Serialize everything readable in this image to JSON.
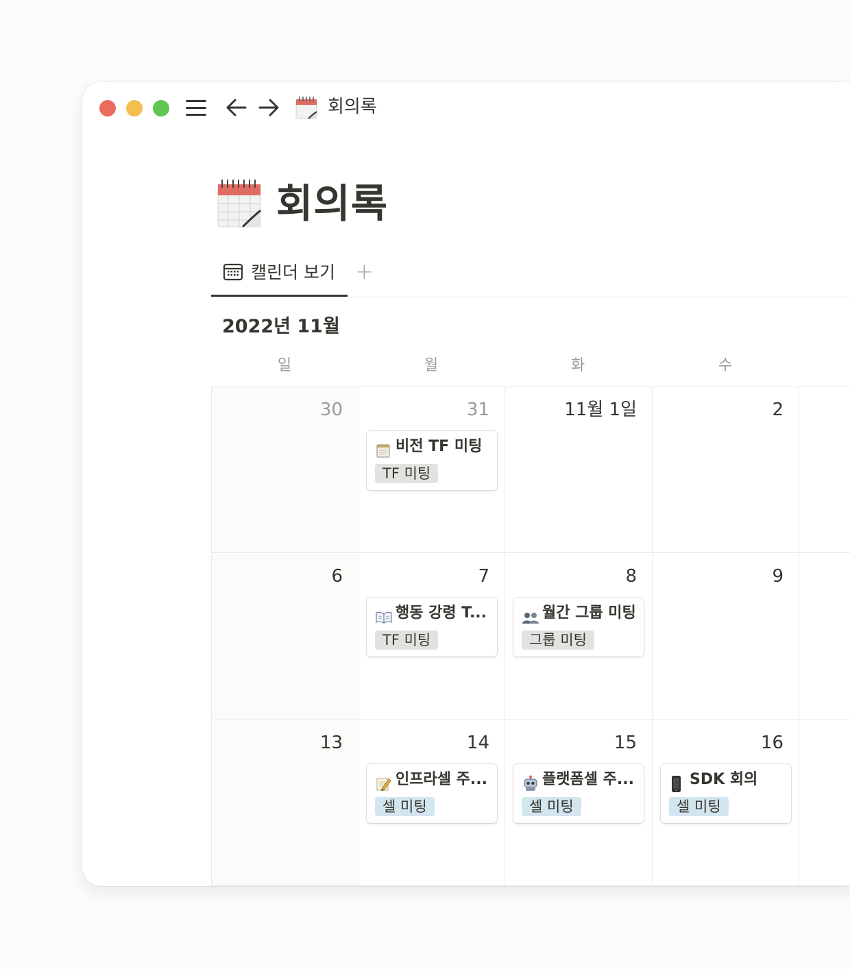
{
  "window": {
    "title": "회의록",
    "title_icon": "spiral-calendar-icon",
    "buttons": {
      "close": "close-button",
      "minimize": "minimize-button",
      "zoom": "zoom-button"
    },
    "nav": {
      "menu_icon": "menu-icon",
      "back_icon": "arrow-left-icon",
      "forward_icon": "arrow-right-icon"
    }
  },
  "page": {
    "icon": "spiral-calendar-icon",
    "title": "회의록"
  },
  "views": {
    "tabs": [
      {
        "label": "캘린더 보기",
        "icon": "calendar-view-icon",
        "active": true
      }
    ],
    "add_label": "+"
  },
  "calendar": {
    "month_label": "2022년 11월",
    "weekdays": [
      "일",
      "월",
      "화",
      "수"
    ],
    "weeks": [
      [
        {
          "day": "30",
          "muted": true,
          "events": []
        },
        {
          "day": "31",
          "muted": true,
          "events": [
            {
              "icon": "notepad-icon",
              "title": "비전 TF 미팅",
              "tag": "TF 미팅",
              "tag_color": "#e3e2e0"
            }
          ]
        },
        {
          "day": "11월 1일",
          "muted": false,
          "events": []
        },
        {
          "day": "2",
          "muted": false,
          "events": []
        }
      ],
      [
        {
          "day": "6",
          "muted": false,
          "events": []
        },
        {
          "day": "7",
          "muted": false,
          "events": [
            {
              "icon": "open-book-icon",
              "title": "행동 강령 T...",
              "tag": "TF 미팅",
              "tag_color": "#e3e2e0"
            }
          ]
        },
        {
          "day": "8",
          "muted": false,
          "events": [
            {
              "icon": "people-icon",
              "title": "월간 그룹 미팅",
              "tag": "그룹 미팅",
              "tag_color": "#e3e2e0"
            }
          ]
        },
        {
          "day": "9",
          "muted": false,
          "events": []
        }
      ],
      [
        {
          "day": "13",
          "muted": false,
          "events": []
        },
        {
          "day": "14",
          "muted": false,
          "events": [
            {
              "icon": "memo-icon",
              "title": "인프라셀 주...",
              "tag": "셀 미팅",
              "tag_color": "#d3e5ef"
            }
          ]
        },
        {
          "day": "15",
          "muted": false,
          "events": [
            {
              "icon": "robot-icon",
              "title": "플랫폼셀 주...",
              "tag": "셀 미팅",
              "tag_color": "#d3e5ef"
            }
          ]
        },
        {
          "day": "16",
          "muted": false,
          "events": [
            {
              "icon": "mobile-phone-icon",
              "title": "SDK 회의",
              "tag": "셀 미팅",
              "tag_color": "#d3e5ef"
            }
          ]
        }
      ]
    ]
  }
}
